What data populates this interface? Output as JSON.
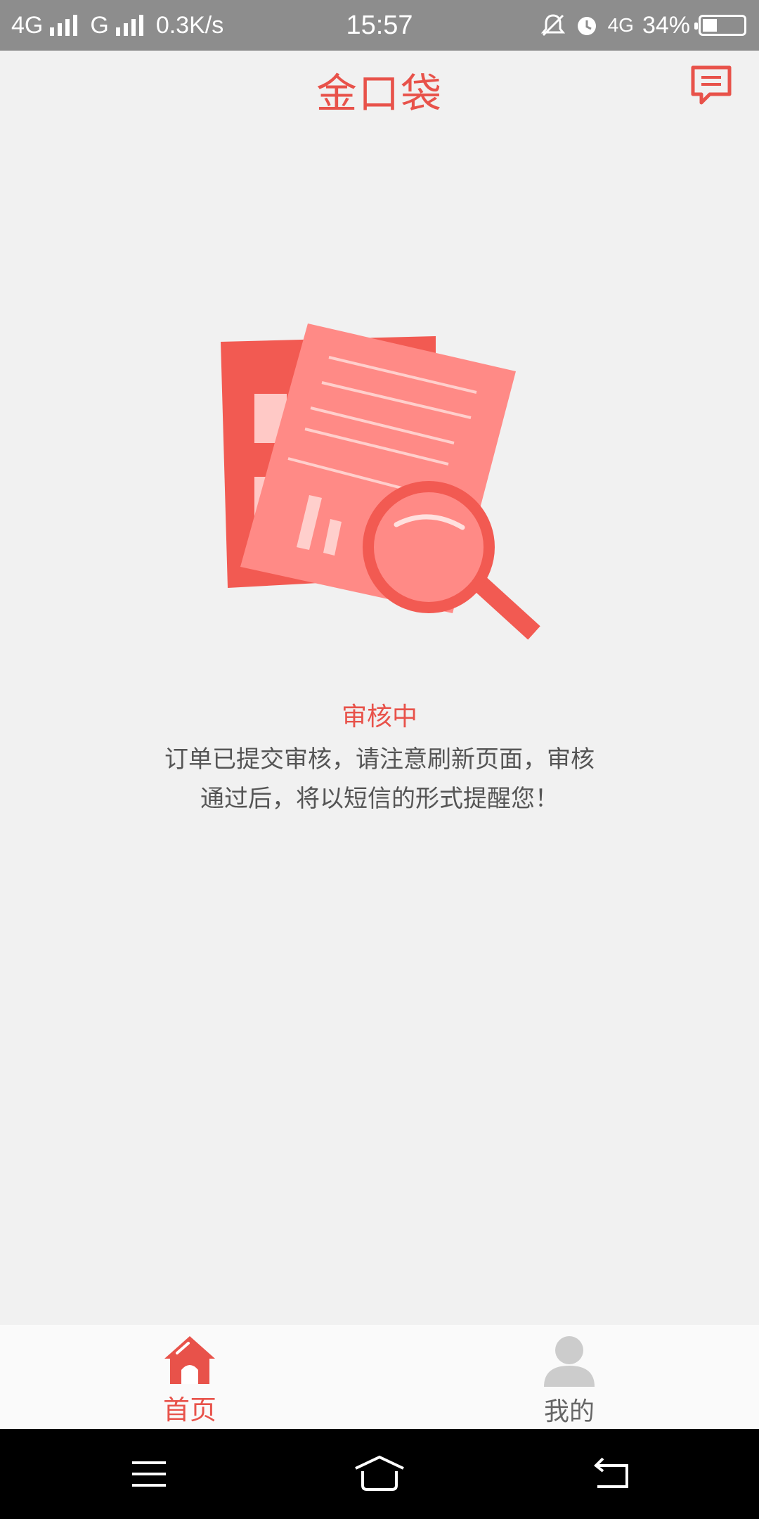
{
  "status_bar": {
    "net1": "4G",
    "net2": "G",
    "speed": "0.3K/s",
    "time": "15:57",
    "net3": "4G",
    "battery": "34%"
  },
  "header": {
    "title": "金口袋"
  },
  "main": {
    "status": "审核中",
    "message_line1": "订单已提交审核，请注意刷新页面，审核",
    "message_line2": "通过后，将以短信的形式提醒您！"
  },
  "tabs": [
    {
      "label": "首页",
      "icon": "home-icon",
      "active": true
    },
    {
      "label": "我的",
      "icon": "person-icon",
      "active": false
    }
  ],
  "colors": {
    "accent": "#e8524a",
    "background": "#f1f1f1",
    "status_bar": "#8d8d8d",
    "inactive": "#cccccc"
  }
}
